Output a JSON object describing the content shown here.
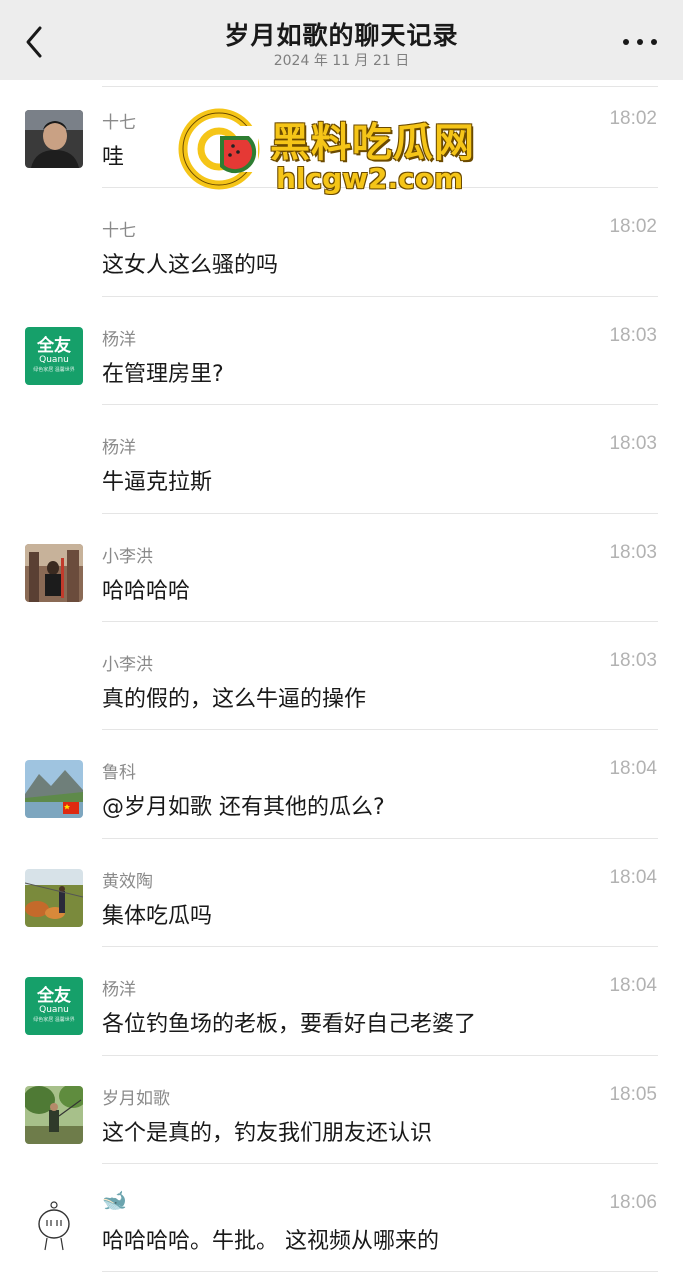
{
  "header": {
    "title": "岁月如歌的聊天记录",
    "subtitle": "2024 年 11 月 21 日"
  },
  "watermark": {
    "name": "黑料吃瓜网",
    "url": "hlcgw2.com"
  },
  "messages": [
    {
      "sender": "十七",
      "time": "18:02",
      "text": "哇",
      "avatar": "man-photo"
    },
    {
      "sender": "十七",
      "time": "18:02",
      "text": "这女人这么骚的吗",
      "avatar": ""
    },
    {
      "sender": "杨洋",
      "time": "18:03",
      "text": "在管理房里?",
      "avatar": "quanyou-logo"
    },
    {
      "sender": "杨洋",
      "time": "18:03",
      "text": "牛逼克拉斯",
      "avatar": ""
    },
    {
      "sender": "小李洪",
      "time": "18:03",
      "text": "哈哈哈哈",
      "avatar": "gym-photo"
    },
    {
      "sender": "小李洪",
      "time": "18:03",
      "text": "真的假的，这么牛逼的操作",
      "avatar": ""
    },
    {
      "sender": "鲁科",
      "time": "18:04",
      "text": "@岁月如歌 还有其他的瓜么?",
      "avatar": "mountain-lake-photo"
    },
    {
      "sender": "黄效陶",
      "time": "18:04",
      "text": "集体吃瓜吗",
      "avatar": "garden-photo"
    },
    {
      "sender": "杨洋",
      "time": "18:04",
      "text": "各位钓鱼场的老板，要看好自己老婆了",
      "avatar": "quanyou-logo"
    },
    {
      "sender": "岁月如歌",
      "time": "18:05",
      "text": "这个是真的，钓友我们朋友还认识",
      "avatar": "fishing-photo"
    },
    {
      "sender": "🐋",
      "time": "18:06",
      "text": "哈哈哈哈。牛批。 这视频从哪来的",
      "avatar": "cartoon-face"
    }
  ],
  "quanyou_logo": {
    "big": "全友",
    "small": "Quanu",
    "tiny": "绿色家居 温馨世界"
  }
}
